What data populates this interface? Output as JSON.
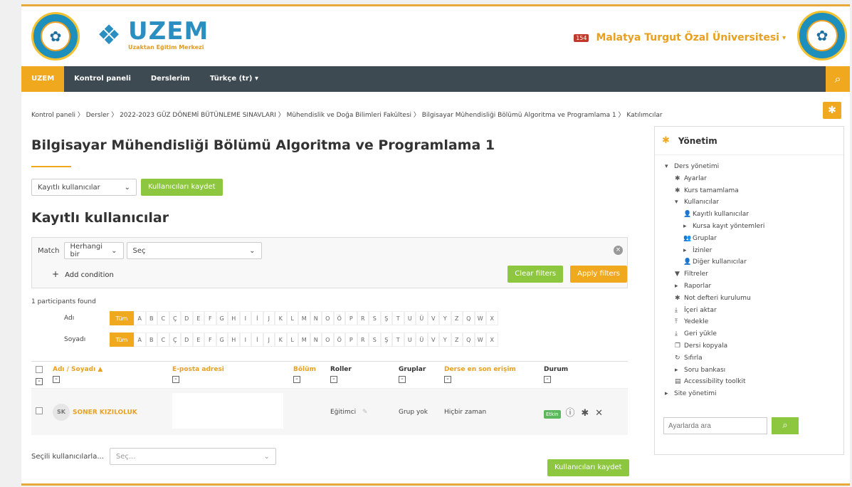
{
  "brand": {
    "uzem_title": "UZEM",
    "uzem_subtitle": "Uzaktan Eğitim Merkezi",
    "university": "Malatya Turgut Özal Üniversitesi",
    "notification_count": "154"
  },
  "nav": {
    "items": [
      "UZEM",
      "Kontrol paneli",
      "Derslerim",
      "Türkçe (tr) ▾"
    ]
  },
  "breadcrumb": "Kontrol paneli  〉 Dersler  〉 2022-2023 GÜZ DÖNEMİ BÜTÜNLEME SINAVLARI  〉 Mühendislik ve Doğa Bilimleri Fakültesi  〉 Bilgisayar Mühendisliği Bölümü Algoritma ve Programlama 1  〉 Katılımcılar",
  "page_title": "Bilgisayar Mühendisliği Bölümü Algoritma ve Programlama 1",
  "enrol": {
    "select_value": "Kayıtlı kullanıcılar",
    "button": "Kullanıcıları kaydet"
  },
  "section_title": "Kayıtlı kullanıcılar",
  "filter": {
    "match_label": "Match",
    "match_value": "Herhangi bir",
    "select_value": "Seç",
    "add_condition": "Add condition",
    "clear": "Clear filters",
    "apply": "Apply filters"
  },
  "found_text": "1 participants found",
  "initials": {
    "first_label": "Adı",
    "last_label": "Soyadı",
    "all": "Tüm",
    "letters": [
      "A",
      "B",
      "C",
      "Ç",
      "D",
      "E",
      "F",
      "G",
      "H",
      "I",
      "İ",
      "J",
      "K",
      "L",
      "M",
      "N",
      "O",
      "Ö",
      "P",
      "R",
      "S",
      "Ş",
      "T",
      "U",
      "Ü",
      "V",
      "Y",
      "Z",
      "Q",
      "W",
      "X"
    ]
  },
  "table": {
    "headers": {
      "name": "Adı / Soyadı",
      "email": "E-posta adresi",
      "department": "Bölüm",
      "roles": "Roller",
      "groups": "Gruplar",
      "last_access": "Derse en son erişim",
      "status": "Durum"
    },
    "rows": [
      {
        "initials": "SK",
        "name": "SONER KIZILOLUK",
        "role": "Eğitimci",
        "groups": "Grup yok",
        "last_access": "Hiçbir zaman",
        "status": "Etkin"
      }
    ]
  },
  "bulk": {
    "label": "Seçili kullanıcılarla...",
    "select_value": "Seç..."
  },
  "save_button_bottom": "Kullanıcıları kaydet",
  "sidebar": {
    "title": "Yönetim",
    "tree": [
      {
        "label": "Ders yönetimi",
        "level": 1,
        "icon": "▾"
      },
      {
        "label": "Ayarlar",
        "level": 2,
        "icon": "✱"
      },
      {
        "label": "Kurs tamamlama",
        "level": 2,
        "icon": "✱"
      },
      {
        "label": "Kullanıcılar",
        "level": 2,
        "icon": "▾"
      },
      {
        "label": "Kayıtlı kullanıcılar",
        "level": 3,
        "icon": "👤"
      },
      {
        "label": "Kursa kayıt yöntemleri",
        "level": 3,
        "icon": "▸"
      },
      {
        "label": "Gruplar",
        "level": 3,
        "icon": "👥"
      },
      {
        "label": "İzinler",
        "level": 3,
        "icon": "▸"
      },
      {
        "label": "Diğer kullanıcılar",
        "level": 3,
        "icon": "👤"
      },
      {
        "label": "Filtreler",
        "level": 2,
        "icon": "▼"
      },
      {
        "label": "Raporlar",
        "level": 2,
        "icon": "▸"
      },
      {
        "label": "Not defteri kurulumu",
        "level": 2,
        "icon": "✱"
      },
      {
        "label": "İçeri aktar",
        "level": 2,
        "icon": "⤓"
      },
      {
        "label": "Yedekle",
        "level": 2,
        "icon": "⤒"
      },
      {
        "label": "Geri yükle",
        "level": 2,
        "icon": "⤓"
      },
      {
        "label": "Dersi kopyala",
        "level": 2,
        "icon": "❐"
      },
      {
        "label": "Sıfırla",
        "level": 2,
        "icon": "↻"
      },
      {
        "label": "Soru bankası",
        "level": 2,
        "icon": "▸"
      },
      {
        "label": "Accessibility toolkit",
        "level": 2,
        "icon": "▤"
      },
      {
        "label": "Site yönetimi",
        "level": 1,
        "icon": "▸"
      }
    ],
    "search_placeholder": "Ayarlarda ara"
  }
}
